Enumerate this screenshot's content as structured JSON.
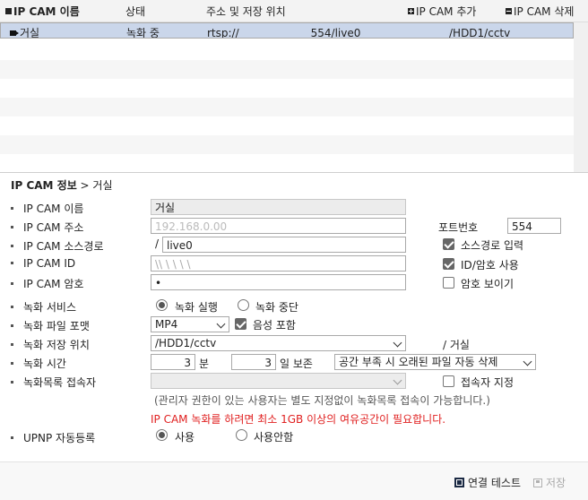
{
  "list": {
    "headers": {
      "name": "IP CAM 이름",
      "status": "상태",
      "address": "주소 및 저장 위치",
      "add": "IP CAM 추가",
      "delete": "IP CAM 삭제"
    },
    "rows": [
      {
        "name": "거실",
        "status": "녹화 중",
        "url_prefix": "rtsp://",
        "url_suffix": "554/live0",
        "storage": "/HDD1/cctv"
      }
    ]
  },
  "panel": {
    "title_bold": "IP CAM 정보",
    "title_rest": " > 거실"
  },
  "form": {
    "name_label": "IP CAM 이름",
    "name_value": "거실",
    "address_label": "IP CAM 주소",
    "address_value": "192.168.0.00",
    "port_label": "포트번호",
    "port_value": "554",
    "source_label": "IP CAM 소스경로",
    "source_prefix": "/",
    "source_value": "live0",
    "source_check_label": "소스경로 입력",
    "id_label": "IP CAM ID",
    "id_value": "\\\\ \\ \\ \\ \\",
    "id_check_label": "ID/암호 사용",
    "pw_label": "IP CAM 암호",
    "pw_value": "•",
    "pw_check_label": "암호 보이기",
    "rec_service_label": "녹화 서비스",
    "rec_on_label": "녹화 실행",
    "rec_off_label": "녹화 중단",
    "format_label": "녹화 파일 포맷",
    "format_value": "MP4",
    "audio_label": "음성 포함",
    "location_label": "녹화 저장 위치",
    "location_value": "/HDD1/cctv",
    "location_suffix": "/ 거실",
    "time_label": "녹화 시간",
    "time_minutes": "3",
    "minutes_unit": "분",
    "time_days": "3",
    "days_unit": "일 보존",
    "retention_value": "공간 부족 시 오래된 파일 자동 삭제",
    "viewer_label": "녹화목록 접속자",
    "viewer_select": "",
    "viewer_check_label": "접속자 지정",
    "note": "(관리자 권한이 있는 사용자는 별도 지정없이 녹화목록 접속이 가능합니다.)",
    "warning": "IP CAM 녹화를 하려면 최소 1GB 이상의 여유공간이 필요합니다.",
    "upnp_label": "UPNP 자동등록",
    "upnp_on": "사용",
    "upnp_off": "사용안함"
  },
  "footer": {
    "test_label": "연결 테스트",
    "save_label": "저장"
  },
  "colors": {
    "selected_row": "#cad6ea",
    "warning": "#e02020"
  }
}
